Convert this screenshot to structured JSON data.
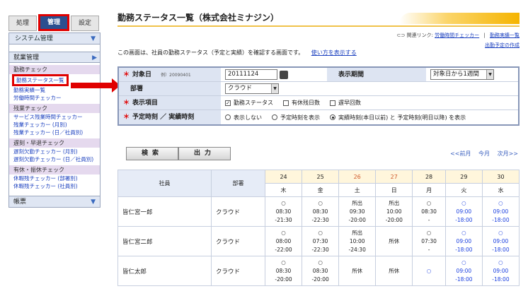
{
  "sidebar": {
    "tabs": [
      "処理",
      "管理",
      "設定"
    ],
    "system_label": "システム管理",
    "section_label": "就業管理",
    "group_work": "勤務チェック",
    "links_work": [
      "勤務ステータス一覧",
      "勤務実績一覧",
      "労働時間チェッカー"
    ],
    "group_overtime": "残業チェック",
    "links_overtime": [
      "サービス残業時間チェッカー",
      "残業チェッカー (月別)",
      "残業チェッカー (日／社員別)"
    ],
    "group_late": "遅刻・早退チェック",
    "links_late": [
      "遅刻欠勤チェッカー (月別)",
      "遅刻欠勤チェッカー (日／社員別)"
    ],
    "group_holiday": "有休・振休チェック",
    "links_holiday": [
      "休暇残チェッカー (部署別)",
      "休暇残チェッカー (社員別)"
    ],
    "foot_label": "帳票"
  },
  "page": {
    "title": "勤務ステータス一覧（株式会社ミナジン）",
    "related_label": "関連リンク:",
    "related_link1": "労働時間チェッカー",
    "related_sep": "|",
    "related_link2": "勤務実績一覧",
    "related_link3": "出勤予定の作成",
    "description": "この画面は、社員の勤務ステータス（予定と実績）を確認する画面です。",
    "howto_link": "使い方を表示する"
  },
  "form": {
    "date_label": "対象日",
    "date_example": "例）20090401",
    "date_value": "20111124",
    "period_label": "表示期間",
    "period_value": "対象日から1週間",
    "dept_label": "部署",
    "dept_value": "クラウド",
    "items_label": "表示項目",
    "item1": "勤務ステータス",
    "item2": "有休残日数",
    "item3": "遅早回数",
    "time_label": "予定時刻 ／ 実績時刻",
    "radio1": "表示しない",
    "radio2": "予定時刻を表示",
    "radio3": "実績時刻(本日以前) と 予定時刻(明日以降) を表示",
    "required_mark": "＊",
    "check_mark": "✓"
  },
  "buttons": {
    "search": "検索",
    "output": "出力"
  },
  "nav": {
    "prev": "<<前月",
    "current": "今月",
    "next": "次月>>"
  },
  "grid": {
    "col_employee": "社員",
    "col_dept": "部署",
    "dates": [
      "24",
      "25",
      "26",
      "27",
      "28",
      "29",
      "30"
    ],
    "weekdays": [
      "木",
      "金",
      "土",
      "日",
      "月",
      "火",
      "水"
    ],
    "rows": [
      {
        "name": "皆仁宮一郎",
        "dept": "クラウド",
        "cells": [
          [
            "○",
            "08:30",
            "-21:30"
          ],
          [
            "○",
            "08:30",
            "-22:30"
          ],
          [
            "所出",
            "09:30",
            "-20:00"
          ],
          [
            "所出",
            "10:00",
            "-20:00"
          ],
          [
            "○",
            "08:30",
            "-"
          ],
          [
            "○",
            "09:00",
            "-18:00"
          ],
          [
            "○",
            "09:00",
            "-18:00"
          ]
        ]
      },
      {
        "name": "皆仁宮二郎",
        "dept": "クラウド",
        "cells": [
          [
            "○",
            "08:00",
            "-22:00"
          ],
          [
            "○",
            "07:30",
            "-22:30"
          ],
          [
            "所出",
            "10:00",
            "-24:30"
          ],
          [
            "所休",
            "",
            ""
          ],
          [
            "○",
            "07:30",
            "-"
          ],
          [
            "○",
            "09:00",
            "-18:00"
          ],
          [
            "○",
            "09:00",
            "-18:00"
          ]
        ]
      },
      {
        "name": "皆仁太郎",
        "dept": "クラウド",
        "cells": [
          [
            "○",
            "08:30",
            "-20:00"
          ],
          [
            "○",
            "08:30",
            "-20:00"
          ],
          [
            "所休",
            "",
            ""
          ],
          [
            "所休",
            "",
            ""
          ],
          [
            "○",
            "",
            ""
          ],
          [
            "○",
            "09:00",
            "-18:00"
          ],
          [
            "○",
            "09:00",
            "-18:00"
          ]
        ]
      }
    ]
  }
}
